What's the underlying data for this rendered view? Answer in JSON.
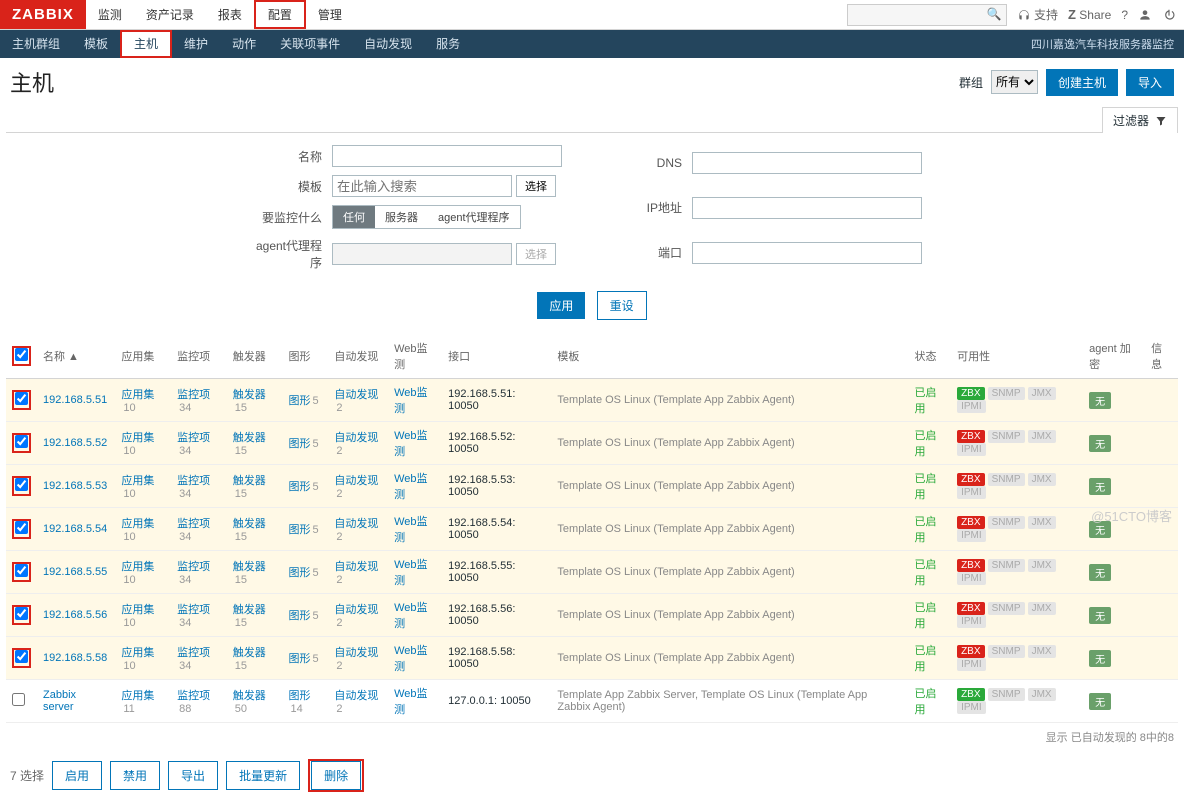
{
  "topnav": {
    "logo": "ZABBIX",
    "items": [
      "监测",
      "资产记录",
      "报表",
      "配置",
      "管理"
    ],
    "highlight_index": 3
  },
  "topright": {
    "support": "支持",
    "share": "Share"
  },
  "subnav": {
    "items": [
      "主机群组",
      "模板",
      "主机",
      "维护",
      "动作",
      "关联项事件",
      "自动发现",
      "服务"
    ],
    "active_index": 2,
    "highlight_index": 2,
    "right_text": "四川嘉逸汽车科技服务器监控"
  },
  "page": {
    "title": "主机",
    "group_label": "群组",
    "group_value": "所有",
    "btn_create": "创建主机",
    "btn_import": "导入"
  },
  "filterbar": {
    "label": "过滤器"
  },
  "filter": {
    "left": {
      "name_label": "名称",
      "template_label": "模板",
      "template_placeholder": "在此输入搜索",
      "template_select": "选择",
      "monitor_label": "要监控什么",
      "segments": [
        "任何",
        "服务器",
        "agent代理程序"
      ],
      "segment_on": 0,
      "proxy_label": "agent代理程序",
      "proxy_select": "选择"
    },
    "right": {
      "dns_label": "DNS",
      "ip_label": "IP地址",
      "port_label": "端口"
    },
    "actions": {
      "apply": "应用",
      "reset": "重设"
    }
  },
  "columns": {
    "name": "名称",
    "apps": "应用集",
    "items": "监控项",
    "triggers": "触发器",
    "graphs": "图形",
    "discovery": "自动发现",
    "web": "Web监测",
    "interface": "接口",
    "templates": "模板",
    "status": "状态",
    "availability": "可用性",
    "encryption": "agent 加密",
    "info": "信息"
  },
  "common": {
    "apps_link": "应用集",
    "items_link": "监控项",
    "triggers_link": "触发器",
    "graphs_link": "图形",
    "discovery_link": "自动发现",
    "web_link": "Web监测",
    "status_enabled": "已启用",
    "none": "无"
  },
  "rows": [
    {
      "checked": true,
      "yellow": true,
      "name": "192.168.5.51",
      "apps": 10,
      "items": 34,
      "triggers": 15,
      "graphs": 5,
      "discovery": 2,
      "web": "",
      "interface": "192.168.5.51: 10050",
      "templates": "Template OS Linux (Template App Zabbix Agent)",
      "zbx_green": true
    },
    {
      "checked": true,
      "yellow": true,
      "name": "192.168.5.52",
      "apps": 10,
      "items": 34,
      "triggers": 15,
      "graphs": 5,
      "discovery": 2,
      "web": "",
      "interface": "192.168.5.52: 10050",
      "templates": "Template OS Linux (Template App Zabbix Agent)",
      "zbx_green": false
    },
    {
      "checked": true,
      "yellow": true,
      "name": "192.168.5.53",
      "apps": 10,
      "items": 34,
      "triggers": 15,
      "graphs": 5,
      "discovery": 2,
      "web": "",
      "interface": "192.168.5.53: 10050",
      "templates": "Template OS Linux (Template App Zabbix Agent)",
      "zbx_green": false
    },
    {
      "checked": true,
      "yellow": true,
      "name": "192.168.5.54",
      "apps": 10,
      "items": 34,
      "triggers": 15,
      "graphs": 5,
      "discovery": 2,
      "web": "",
      "interface": "192.168.5.54: 10050",
      "templates": "Template OS Linux (Template App Zabbix Agent)",
      "zbx_green": false
    },
    {
      "checked": true,
      "yellow": true,
      "name": "192.168.5.55",
      "apps": 10,
      "items": 34,
      "triggers": 15,
      "graphs": 5,
      "discovery": 2,
      "web": "",
      "interface": "192.168.5.55: 10050",
      "templates": "Template OS Linux (Template App Zabbix Agent)",
      "zbx_green": false
    },
    {
      "checked": true,
      "yellow": true,
      "name": "192.168.5.56",
      "apps": 10,
      "items": 34,
      "triggers": 15,
      "graphs": 5,
      "discovery": 2,
      "web": "",
      "interface": "192.168.5.56: 10050",
      "templates": "Template OS Linux (Template App Zabbix Agent)",
      "zbx_green": false
    },
    {
      "checked": true,
      "yellow": true,
      "name": "192.168.5.58",
      "apps": 10,
      "items": 34,
      "triggers": 15,
      "graphs": 5,
      "discovery": 2,
      "web": "",
      "interface": "192.168.5.58: 10050",
      "templates": "Template OS Linux (Template App Zabbix Agent)",
      "zbx_green": false
    },
    {
      "checked": false,
      "yellow": false,
      "name": "Zabbix server",
      "apps": 11,
      "items": 88,
      "triggers": 50,
      "graphs": 14,
      "discovery": 2,
      "web": "",
      "interface": "127.0.0.1: 10050",
      "templates": "Template App Zabbix Server, Template OS Linux (Template App Zabbix Agent)",
      "zbx_green": true
    }
  ],
  "summary": "显示 已自动发现的 8中的8",
  "footer": {
    "selected": "7 选择",
    "enable": "启用",
    "disable": "禁用",
    "export": "导出",
    "massupdate": "批量更新",
    "delete": "删除"
  },
  "watermark": "@51CTO博客"
}
